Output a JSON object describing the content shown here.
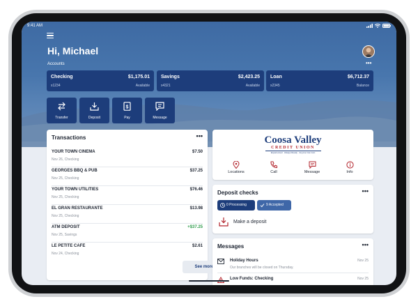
{
  "status_bar": {
    "time": "9:41 AM"
  },
  "header": {
    "greeting": "Hi, Michael"
  },
  "accounts": {
    "label": "Accounts",
    "more": "•••",
    "items": [
      {
        "name": "Checking",
        "number": "x1234",
        "amount": "$1,175.01",
        "amount_label": "Available"
      },
      {
        "name": "Savings",
        "number": "x4321",
        "amount": "$2,423.25",
        "amount_label": "Available"
      },
      {
        "name": "Loan",
        "number": "x2345",
        "amount": "$6,712.37",
        "amount_label": "Balance"
      }
    ]
  },
  "quick_actions": [
    {
      "label": "Transfer",
      "icon": "transfer-icon"
    },
    {
      "label": "Deposit",
      "icon": "deposit-icon"
    },
    {
      "label": "Pay",
      "icon": "pay-icon"
    },
    {
      "label": "Message",
      "icon": "message-icon"
    }
  ],
  "transactions": {
    "title": "Transactions",
    "more": "•••",
    "see_more": "See more",
    "items": [
      {
        "merchant": "YOUR TOWN CINEMA",
        "detail": "Nov 26, Checking",
        "amount": "$7.50"
      },
      {
        "merchant": "GEORGES BBQ & PUB",
        "detail": "Nov 25, Checking",
        "amount": "$37.25"
      },
      {
        "merchant": "YOUR TOWN UTILITIES",
        "detail": "Nov 25, Checking",
        "amount": "$76.46"
      },
      {
        "merchant": "EL GRAN RESTAURANTE",
        "detail": "Nov 25, Checking",
        "amount": "$13.98"
      },
      {
        "merchant": "ATM DEPOSIT",
        "detail": "Nov 25, Savings",
        "amount": "+$37.25"
      },
      {
        "merchant": "LE PETITE CAFE",
        "detail": "Nov 24, Checking",
        "amount": "$2.61"
      }
    ]
  },
  "institution": {
    "name_line1": "Coosa Valley",
    "name_line2": "CREDIT UNION",
    "tagline": "Experienced · Always Ready · Anyone Can Join",
    "actions": [
      {
        "label": "Locations",
        "icon": "location-pin-icon"
      },
      {
        "label": "Call",
        "icon": "phone-icon"
      },
      {
        "label": "Message",
        "icon": "chat-icon"
      },
      {
        "label": "Info",
        "icon": "info-icon"
      }
    ]
  },
  "deposit_checks": {
    "title": "Deposit checks",
    "more": "•••",
    "processing": "0 Processing",
    "accepted": "9 Accepted",
    "make_deposit": "Make a deposit"
  },
  "messages": {
    "title": "Messages",
    "more": "•••",
    "items": [
      {
        "subject": "Holiday Hours",
        "preview": "Our branches will be closed on Thursday.",
        "date": "Nov 25"
      },
      {
        "subject": "Low Funds: Checking",
        "preview": "",
        "date": "Nov 25"
      }
    ]
  },
  "colors": {
    "brand_navy": "#1d3d7b",
    "brand_red": "#b2232b",
    "positive": "#2d9b4a",
    "hero_blue": "#4876ad"
  }
}
